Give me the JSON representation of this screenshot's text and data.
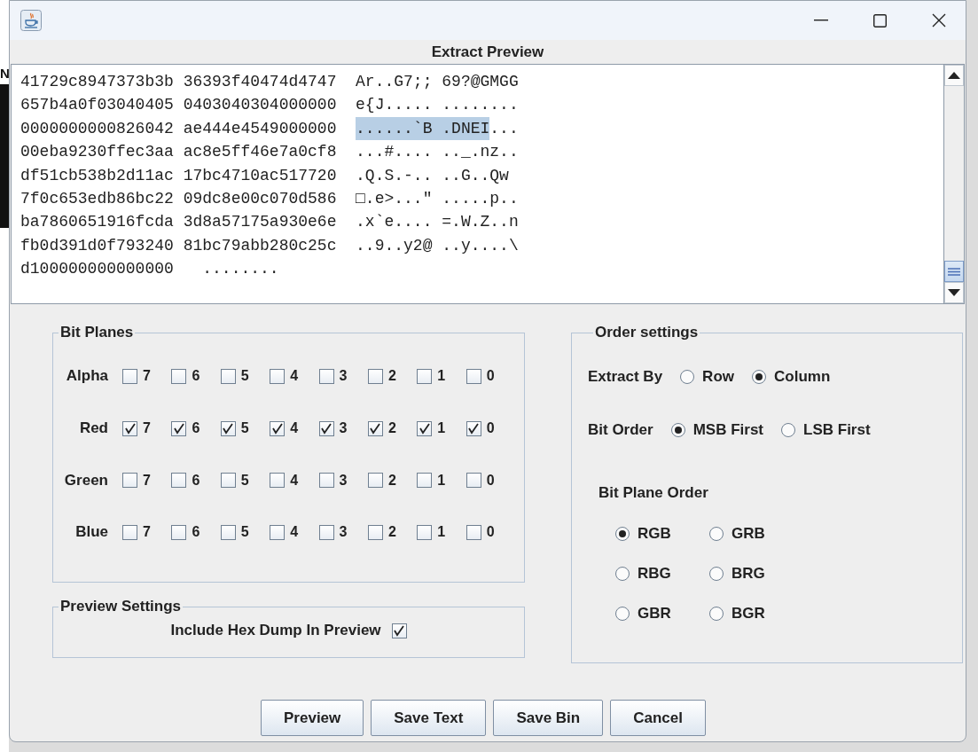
{
  "background_window": {
    "text": "N"
  },
  "window": {
    "title": "Extract Preview"
  },
  "preview": {
    "lines": [
      {
        "parts": [
          {
            "text": "41729c8947373b3b 36393f40474d4747  Ar..G7;; 69?@GMGG",
            "selected": false
          }
        ]
      },
      {
        "parts": [
          {
            "text": "657b4a0f03040405 0403040304000000  e{J..... ........",
            "selected": false
          }
        ]
      },
      {
        "parts": [
          {
            "text": "0000000000826042 ae444e4549000000  ",
            "selected": false
          },
          {
            "text": "......`B .DNEI",
            "selected": true
          },
          {
            "text": "...",
            "selected": false
          }
        ]
      },
      {
        "parts": [
          {
            "text": "00eba9230ffec3aa ac8e5ff46e7a0cf8  ...#.... .._.nz..",
            "selected": false
          }
        ]
      },
      {
        "parts": [
          {
            "text": "df51cb538b2d11ac 17bc4710ac517720  .Q.S.-.. ..G..Qw",
            "selected": false
          }
        ]
      },
      {
        "parts": [
          {
            "text": "7f0c653edb86bc22 09dc8e00c070d586  □.e>...\" .....p..",
            "selected": false
          }
        ]
      },
      {
        "parts": [
          {
            "text": "ba7860651916fcda 3d8a57175a930e6e  .x`e.... =.W.Z..n",
            "selected": false
          }
        ]
      },
      {
        "parts": [
          {
            "text": "fb0d391d0f793240 81bc79abb280c25c  ..9..y2@ ..y....\\",
            "selected": false
          }
        ]
      },
      {
        "parts": [
          {
            "text": "d100000000000000   ........",
            "selected": false
          }
        ]
      }
    ]
  },
  "bit_planes": {
    "title": "Bit Planes",
    "channels": [
      {
        "name": "Alpha",
        "bits": [
          {
            "label": "7",
            "checked": false
          },
          {
            "label": "6",
            "checked": false
          },
          {
            "label": "5",
            "checked": false
          },
          {
            "label": "4",
            "checked": false
          },
          {
            "label": "3",
            "checked": false
          },
          {
            "label": "2",
            "checked": false
          },
          {
            "label": "1",
            "checked": false
          },
          {
            "label": "0",
            "checked": false
          }
        ]
      },
      {
        "name": "Red",
        "bits": [
          {
            "label": "7",
            "checked": true
          },
          {
            "label": "6",
            "checked": true
          },
          {
            "label": "5",
            "checked": true
          },
          {
            "label": "4",
            "checked": true
          },
          {
            "label": "3",
            "checked": true
          },
          {
            "label": "2",
            "checked": true
          },
          {
            "label": "1",
            "checked": true
          },
          {
            "label": "0",
            "checked": true
          }
        ]
      },
      {
        "name": "Green",
        "bits": [
          {
            "label": "7",
            "checked": false
          },
          {
            "label": "6",
            "checked": false
          },
          {
            "label": "5",
            "checked": false
          },
          {
            "label": "4",
            "checked": false
          },
          {
            "label": "3",
            "checked": false
          },
          {
            "label": "2",
            "checked": false
          },
          {
            "label": "1",
            "checked": false
          },
          {
            "label": "0",
            "checked": false
          }
        ]
      },
      {
        "name": "Blue",
        "bits": [
          {
            "label": "7",
            "checked": false
          },
          {
            "label": "6",
            "checked": false
          },
          {
            "label": "5",
            "checked": false
          },
          {
            "label": "4",
            "checked": false
          },
          {
            "label": "3",
            "checked": false
          },
          {
            "label": "2",
            "checked": false
          },
          {
            "label": "1",
            "checked": false
          },
          {
            "label": "0",
            "checked": false
          }
        ]
      }
    ]
  },
  "preview_settings": {
    "title": "Preview Settings",
    "label": "Include Hex Dump In Preview",
    "checked": true
  },
  "order_settings": {
    "title": "Order settings",
    "extract_by": {
      "label": "Extract By",
      "options": [
        {
          "label": "Row",
          "selected": false
        },
        {
          "label": "Column",
          "selected": true
        }
      ]
    },
    "bit_order": {
      "label": "Bit Order",
      "options": [
        {
          "label": "MSB First",
          "selected": true
        },
        {
          "label": "LSB First",
          "selected": false
        }
      ]
    },
    "bit_plane_order": {
      "label": "Bit Plane Order",
      "options": [
        {
          "label": "RGB",
          "selected": true
        },
        {
          "label": "GRB",
          "selected": false
        },
        {
          "label": "RBG",
          "selected": false
        },
        {
          "label": "BRG",
          "selected": false
        },
        {
          "label": "GBR",
          "selected": false
        },
        {
          "label": "BGR",
          "selected": false
        }
      ]
    }
  },
  "buttons": [
    "Preview",
    "Save Text",
    "Save Bin",
    "Cancel"
  ]
}
